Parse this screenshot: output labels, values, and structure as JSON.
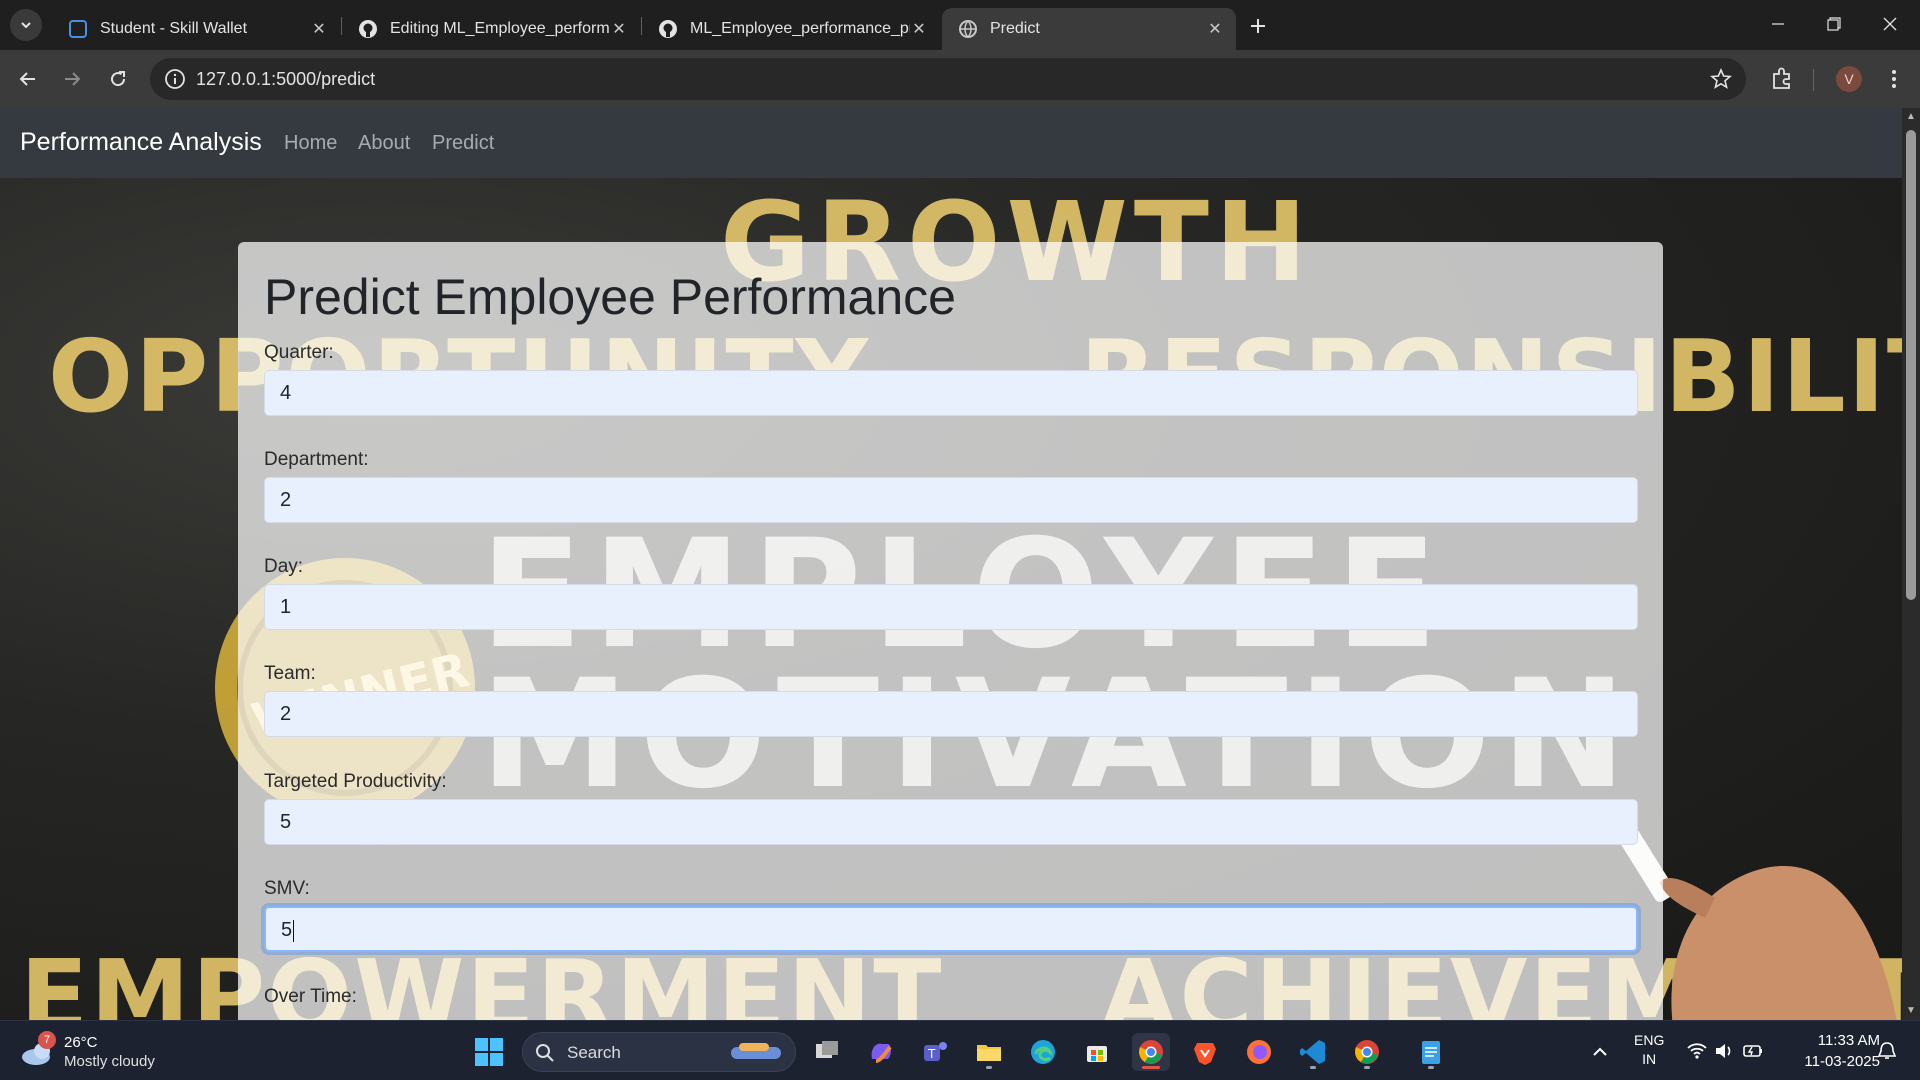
{
  "browser": {
    "tabs": [
      {
        "title": "Student - Skill Wallet",
        "icon": "skill-wallet-icon",
        "active": false
      },
      {
        "title": "Editing ML_Employee_performa",
        "icon": "github-icon",
        "active": false
      },
      {
        "title": "ML_Employee_performance_pre",
        "icon": "github-icon",
        "active": false
      },
      {
        "title": "Predict",
        "icon": "globe-icon",
        "active": true
      }
    ],
    "url": "127.0.0.1:5000/predict",
    "profile_initial": "V"
  },
  "site": {
    "brand": "Performance Analysis",
    "nav": [
      "Home",
      "About",
      "Predict"
    ]
  },
  "background_words": [
    "GROWTH",
    "OPPORTUNITY",
    "RESPONSIBILITY",
    "EMPLOYEE",
    "MOTIVATION",
    "EMPOWERMENT",
    "ACHIEVEMENT",
    "WINNER"
  ],
  "form": {
    "title": "Predict Employee Performance",
    "fields": [
      {
        "label": "Quarter:",
        "value": "4"
      },
      {
        "label": "Department:",
        "value": "2"
      },
      {
        "label": "Day:",
        "value": "1"
      },
      {
        "label": "Team:",
        "value": "2"
      },
      {
        "label": "Targeted Productivity:",
        "value": "5"
      },
      {
        "label": "SMV:",
        "value": "5",
        "focused": true
      },
      {
        "label": "Over Time:",
        "value": ""
      }
    ]
  },
  "taskbar": {
    "weather": {
      "badge": "7",
      "temp": "26°C",
      "condition": "Mostly cloudy"
    },
    "search_label": "Search",
    "lang_line1": "ENG",
    "lang_line2": "IN",
    "time": "11:33 AM",
    "date": "11-03-2025"
  },
  "colors": {
    "navbar": "#343a40",
    "input_bg": "#e8f0fe",
    "focus_ring": "#86b7fe",
    "chalk_yellow": "#f0d070"
  }
}
